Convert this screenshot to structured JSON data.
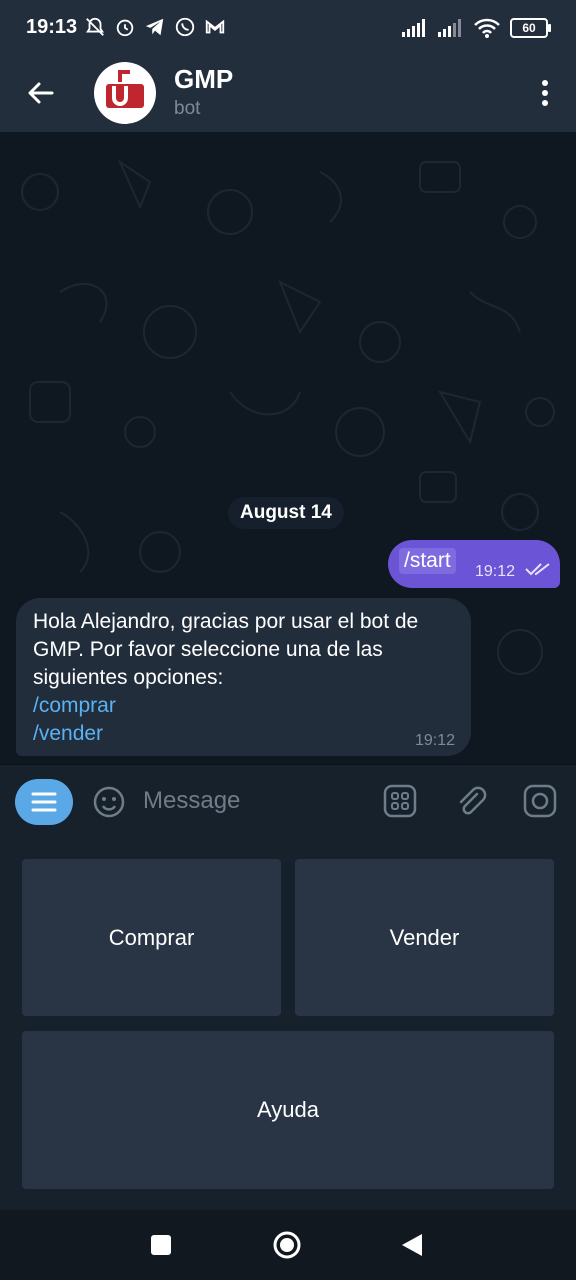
{
  "status_bar": {
    "time": "19:13",
    "battery": "60"
  },
  "chat_header": {
    "title": "GMP",
    "subtitle": "bot"
  },
  "date_separator": "August 14",
  "messages": {
    "outgoing": {
      "command": "/start",
      "time": "19:12"
    },
    "incoming": {
      "text": "Hola Alejandro, gracias por usar el bot de GMP. Por favor seleccione una de las siguientes opciones:",
      "link1": "/comprar",
      "link2": "/vender",
      "time": "19:12"
    }
  },
  "input_bar": {
    "placeholder": "Message"
  },
  "keyboard": {
    "btn1": "Comprar",
    "btn2": "Vender",
    "btn3": "Ayuda"
  },
  "colors": {
    "header_bg": "#232e3c",
    "chat_bg": "#0f1721",
    "outgoing_bubble": "#6b55d6",
    "incoming_bubble": "#222d3b",
    "link": "#5ab2f3",
    "accent": "#5aa9e6",
    "keyboard_button": "#293545"
  },
  "icons": [
    "back-arrow-icon",
    "bot-avatar-logo",
    "more-vertical-icon",
    "double-check-icon",
    "menu-icon",
    "emoji-icon",
    "sticker-icon",
    "attach-icon",
    "camera-icon",
    "nav-square-icon",
    "nav-circle-icon",
    "nav-back-icon"
  ]
}
